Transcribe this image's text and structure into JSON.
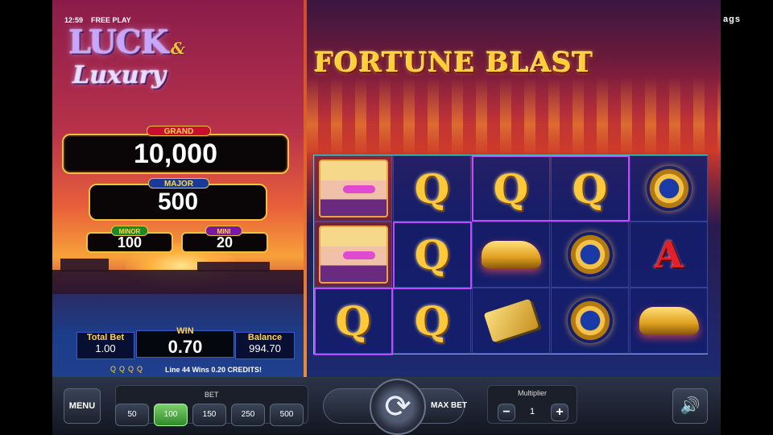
{
  "status": {
    "clock": "12:59",
    "mode": "FREE PLAY"
  },
  "logo": {
    "luck": "LUCK",
    "amp": "&",
    "luxury": "Luxury"
  },
  "jackpots": {
    "grand": {
      "label": "GRAND",
      "value": "10,000",
      "color": "#c8102e"
    },
    "major": {
      "label": "MAJOR",
      "value": "500",
      "color": "#1a3a9a"
    },
    "minor": {
      "label": "MINOR",
      "value": "100",
      "color": "#1a8a2a"
    },
    "mini": {
      "label": "MINI",
      "value": "20",
      "color": "#7a1aa0"
    }
  },
  "stats": {
    "total_bet_label": "Total Bet",
    "total_bet": "1.00",
    "win_label": "WIN",
    "win": "0.70",
    "balance_label": "Balance",
    "balance": "994.70"
  },
  "line_win": "Line 44 Wins 0.20 CREDITS!",
  "bubbles": "QQQQ",
  "game_title": "FORTUNE BLAST",
  "brand": "ags",
  "reels": [
    [
      "lady",
      "lady",
      "Q"
    ],
    [
      "Q",
      "Q",
      "Q"
    ],
    [
      "Q",
      "car",
      "card"
    ],
    [
      "Q",
      "watch",
      "watch"
    ],
    [
      "watch",
      "A",
      "car"
    ]
  ],
  "controls": {
    "menu": "MENU",
    "bet_label": "BET",
    "bets": [
      "50",
      "100",
      "150",
      "250",
      "500"
    ],
    "selected_bet": "100",
    "max_bet": "MAX BET",
    "multiplier_label": "Multiplier",
    "multiplier": "1",
    "minus": "−",
    "plus": "+",
    "spin_icon": "spin-icon",
    "sound_icon": "speaker-icon"
  }
}
